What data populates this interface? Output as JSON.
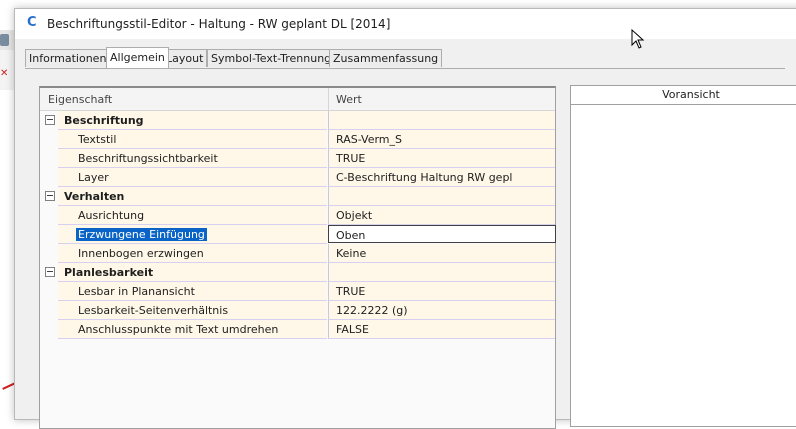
{
  "window": {
    "title": "Beschriftungsstil-Editor - Haltung - RW geplant DL [2014]",
    "icon": "c3d-app-icon"
  },
  "tabs": [
    {
      "label": "Informationen",
      "active": false
    },
    {
      "label": "Allgemein",
      "active": true
    },
    {
      "label": "Layout",
      "active": false
    },
    {
      "label": "Symbol-Text-Trennung",
      "active": false
    },
    {
      "label": "Zusammenfassung",
      "active": false
    }
  ],
  "grid": {
    "col_property": "Eigenschaft",
    "col_value": "Wert",
    "rows": [
      {
        "type": "category",
        "name": "Beschriftung"
      },
      {
        "type": "prop",
        "name": "Textstil",
        "value": "RAS-Verm_S"
      },
      {
        "type": "prop",
        "name": "Beschriftungssichtbarkeit",
        "value": "TRUE"
      },
      {
        "type": "prop",
        "name": "Layer",
        "value": "C-Beschriftung Haltung RW gepl"
      },
      {
        "type": "category",
        "name": "Verhalten"
      },
      {
        "type": "prop",
        "name": "Ausrichtung",
        "value": "Objekt"
      },
      {
        "type": "prop",
        "name": "Erzwungene Einfügung",
        "value": "Oben",
        "selected": true
      },
      {
        "type": "prop",
        "name": "Innenbogen erzwingen",
        "value": "Keine"
      },
      {
        "type": "category",
        "name": "Planlesbarkeit"
      },
      {
        "type": "prop",
        "name": "Lesbar in Planansicht",
        "value": "TRUE"
      },
      {
        "type": "prop",
        "name": "Lesbarkeit-Seitenverhältnis",
        "value": "122.2222 (g)"
      },
      {
        "type": "prop",
        "name": "Anschlusspunkte mit Text umdrehen",
        "value": "FALSE"
      }
    ]
  },
  "preview": {
    "title": "Voransicht"
  },
  "colors": {
    "selection": "#0a64c8",
    "row_bg": "#fff8e8",
    "app_icon": "#2a6fc9"
  }
}
